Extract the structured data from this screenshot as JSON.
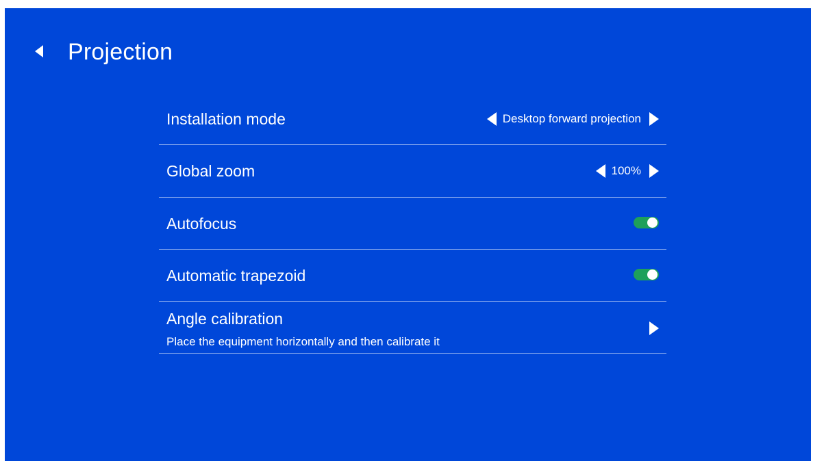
{
  "header": {
    "title": "Projection",
    "back_icon": "back-arrow-icon"
  },
  "settings": {
    "installation_mode": {
      "label": "Installation mode",
      "value": "Desktop forward projection"
    },
    "global_zoom": {
      "label": "Global zoom",
      "value": "100%"
    },
    "autofocus": {
      "label": "Autofocus",
      "enabled": true
    },
    "automatic_trapezoid": {
      "label": "Automatic trapezoid",
      "enabled": true
    },
    "angle_calibration": {
      "label": "Angle calibration",
      "description": "Place the equipment horizontally and then calibrate it"
    }
  },
  "colors": {
    "background": "#0047d9",
    "toggle_on": "#1ea05a",
    "text": "#ffffff"
  }
}
